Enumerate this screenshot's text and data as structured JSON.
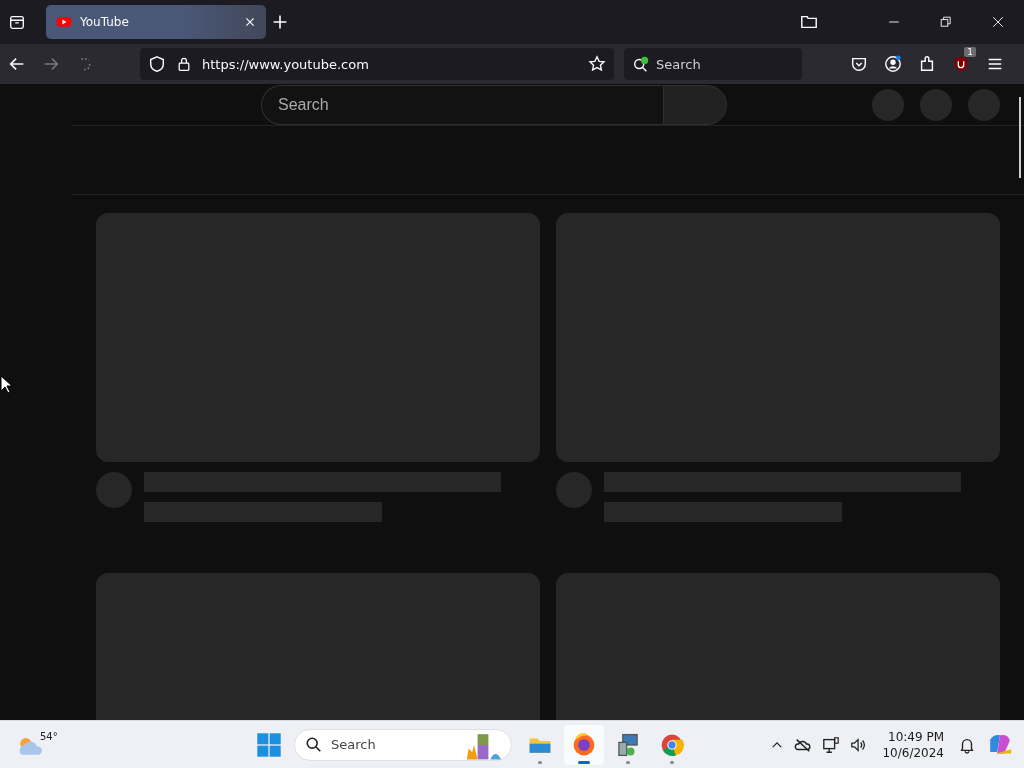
{
  "browser": {
    "tabs": [
      {
        "title": "YouTube",
        "selected": true
      }
    ],
    "address": "https://www.youtube.com",
    "search": {
      "placeholder": "Search"
    },
    "extension_badge": "1"
  },
  "page": {
    "search": {
      "placeholder": "Search"
    },
    "skeleton_cards": [
      {
        "kind": "video"
      },
      {
        "kind": "video"
      },
      {
        "kind": "thumbnail"
      },
      {
        "kind": "thumbnail"
      }
    ]
  },
  "taskbar": {
    "weather": "54°",
    "search": {
      "placeholder": "Search"
    },
    "apps": [
      {
        "kind": "files",
        "selected": false
      },
      {
        "kind": "firefox",
        "selected": true
      },
      {
        "kind": "network",
        "selected": false
      },
      {
        "kind": "chrome",
        "selected": false
      }
    ],
    "time": "10:49 PM",
    "date": "10/6/2024"
  }
}
